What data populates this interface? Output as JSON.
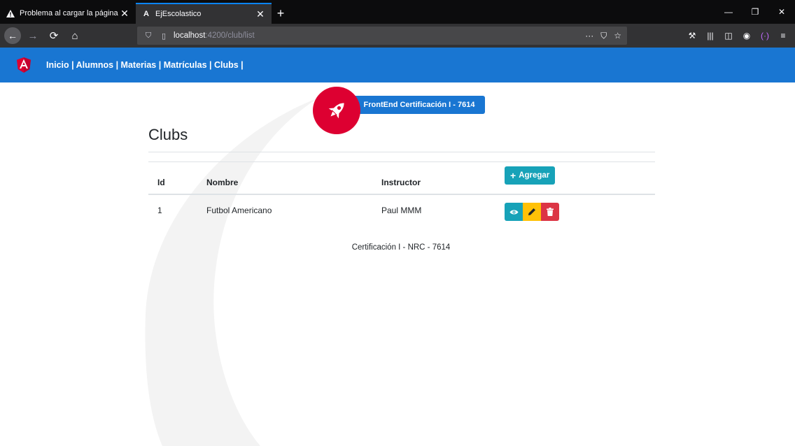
{
  "browser": {
    "tabs": [
      {
        "title": "Problema al cargar la página",
        "icon": "warning-icon",
        "active": false
      },
      {
        "title": "EjEscolastico",
        "icon": "angular-icon",
        "active": true
      }
    ],
    "url_host": "localhost",
    "url_path": ":4200/club/list"
  },
  "header": {
    "nav_label": "Inicio | Alumnos | Materias | Matrículas | Clubs |",
    "bg_color": "#1976d2"
  },
  "badge": {
    "label": "FrontEnd Certificación I - 7614",
    "icon": "rocket-icon",
    "color": "#dd0031"
  },
  "main": {
    "title": "Clubs",
    "table": {
      "headers": [
        "Id",
        "Nombre",
        "Instructor"
      ],
      "add_button_label": "Agregar",
      "rows": [
        {
          "id": "1",
          "nombre": "Futbol Americano",
          "instructor": "Paul MMM"
        }
      ]
    }
  },
  "footer": {
    "text": "Certificación I - NRC - 7614"
  }
}
